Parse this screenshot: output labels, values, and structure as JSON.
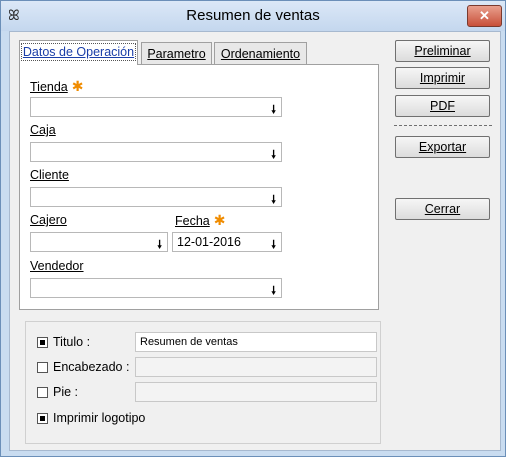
{
  "window": {
    "title": "Resumen de ventas",
    "close_glyph": "✕",
    "app_icon": "ꕤ"
  },
  "tabs": [
    {
      "label": "Datos de Operación",
      "active": true
    },
    {
      "label": "Parametro",
      "active": false
    },
    {
      "label": "Ordenamiento",
      "active": false
    }
  ],
  "form": {
    "tienda": {
      "label": "Tienda",
      "required_mark": "✱",
      "value": ""
    },
    "caja": {
      "label": "Caja",
      "value": ""
    },
    "cliente": {
      "label": "Cliente",
      "value": ""
    },
    "cajero": {
      "label": "Cajero",
      "value": ""
    },
    "fecha": {
      "label": "Fecha",
      "required_mark": "✱",
      "value": "12-01-2016"
    },
    "vendedor": {
      "label": "Vendedor",
      "value": ""
    },
    "dropdown_glyph": "🠗"
  },
  "buttons": {
    "preliminar": "Preliminar",
    "imprimir": "Imprimir",
    "pdf": "PDF",
    "exportar": "Exportar",
    "cerrar": "Cerrar"
  },
  "options": {
    "titulo": {
      "label": "Titulo :",
      "checked": true,
      "value": "Resumen de ventas"
    },
    "encabezado": {
      "label": "Encabezado :",
      "checked": false,
      "value": ""
    },
    "pie": {
      "label": "Pie :",
      "checked": false,
      "value": ""
    },
    "logotipo": {
      "label": "Imprimir logotipo",
      "checked": true
    }
  }
}
